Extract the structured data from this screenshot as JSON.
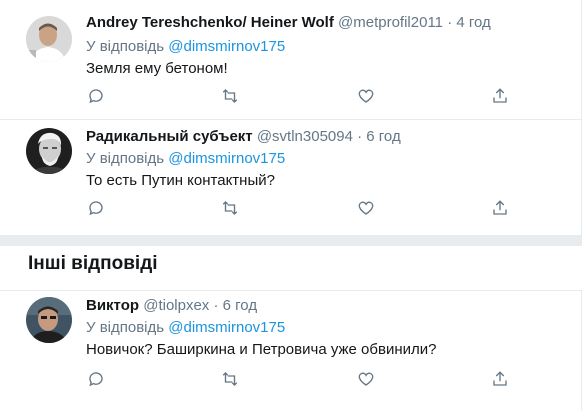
{
  "tweets": [
    {
      "name": "Andrey Tereshchenko/ Heiner Wolf",
      "handle": "@metprofil2011",
      "dot": "·",
      "time": "4 год",
      "reply_prefix": "У відповідь",
      "reply_mention": "@dimsmirnov175",
      "text": "Земля ему бетоном!"
    },
    {
      "name": "Радикальный субъект",
      "handle": "@svtln305094",
      "dot": "·",
      "time": "6 год",
      "reply_prefix": "У відповідь",
      "reply_mention": "@dimsmirnov175",
      "text": "То есть Путин контактный?"
    },
    {
      "name": "Виктор",
      "handle": "@tiolpxex",
      "dot": "·",
      "time": "6 год",
      "reply_prefix": "У відповідь",
      "reply_mention": "@dimsmirnov175",
      "text": "Новичок? Баширкина и Петровича уже обвинили?"
    }
  ],
  "section": {
    "title": "Інші відповіді"
  },
  "action_icons": [
    "reply-icon",
    "retweet-icon",
    "like-icon",
    "share-icon"
  ],
  "colors": {
    "text": "#14171a",
    "secondary": "#657786",
    "link": "#1b95e0",
    "border": "#e6ecf0"
  }
}
